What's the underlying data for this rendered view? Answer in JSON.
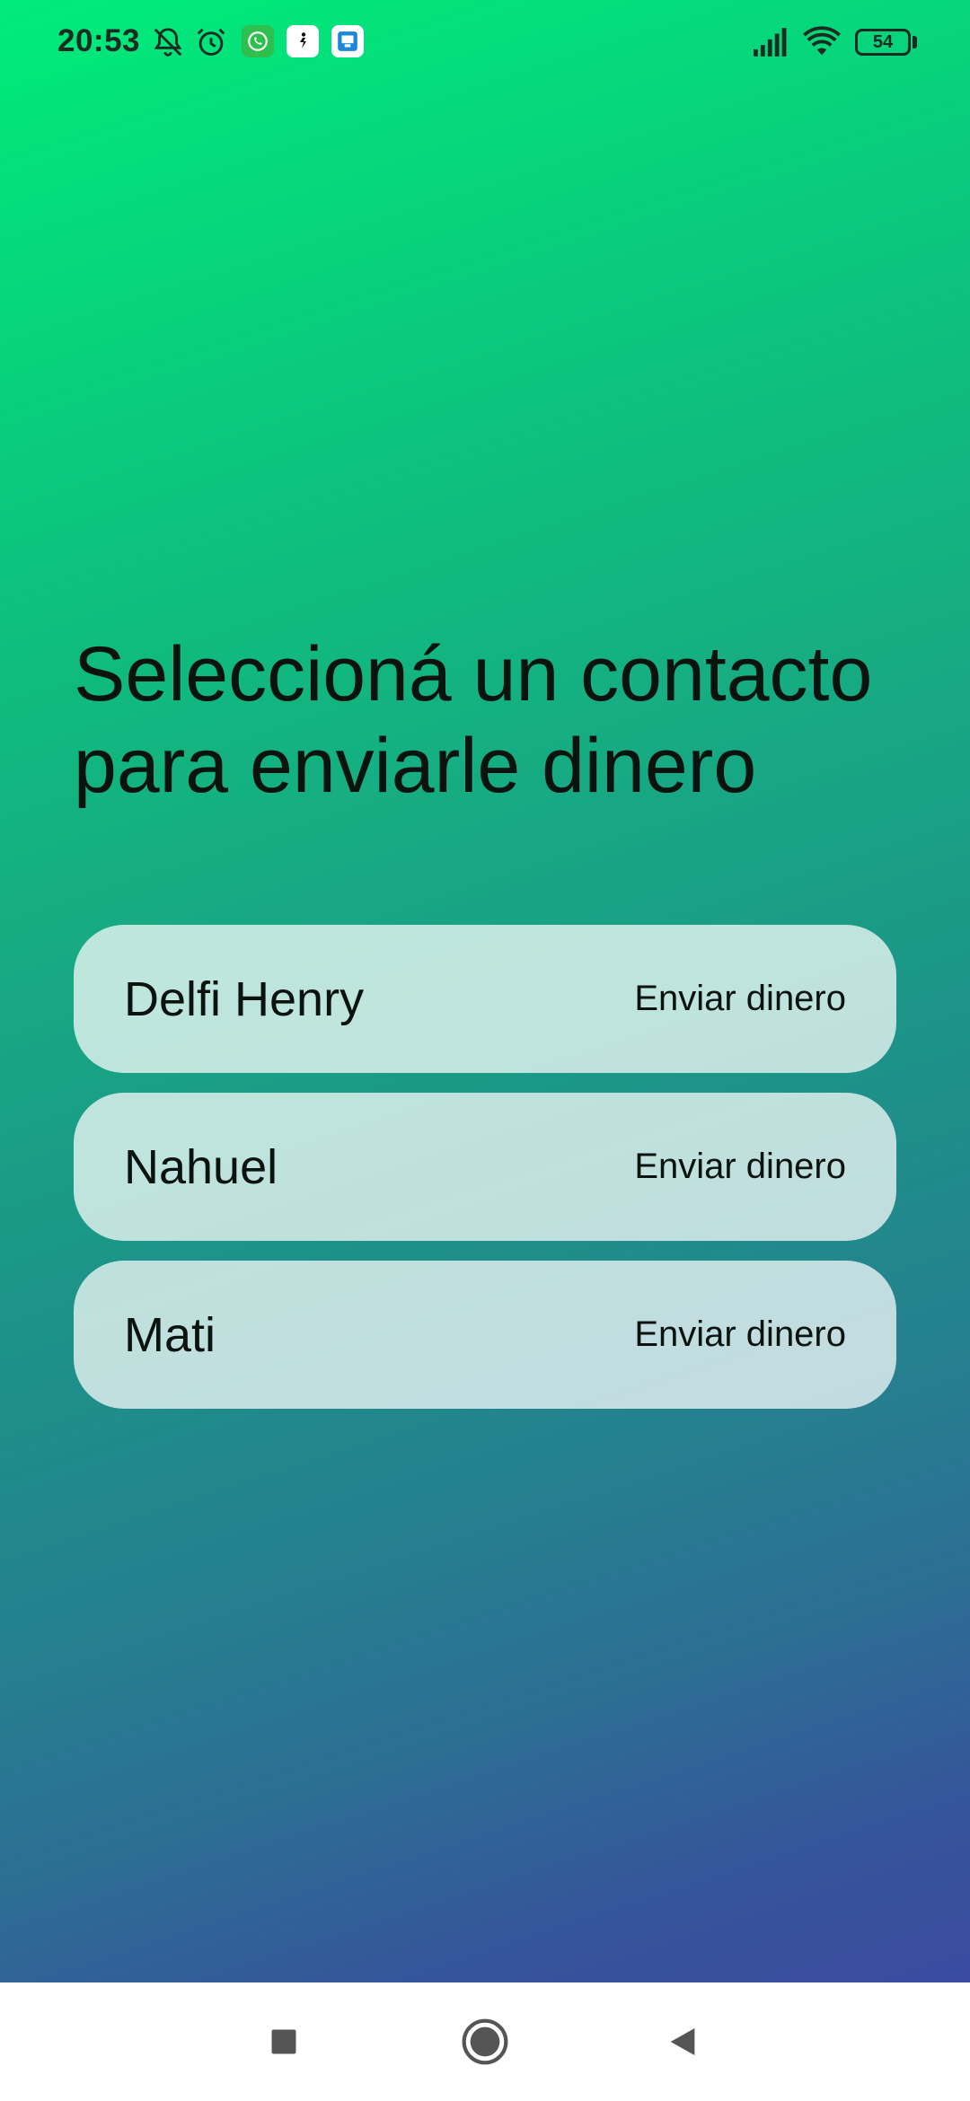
{
  "status_bar": {
    "time": "20:53",
    "battery_level": "54",
    "icons": [
      "bell-off-icon",
      "alarm-icon",
      "whatsapp-icon",
      "app-notification-icon",
      "app-notification-icon-2",
      "signal-icon",
      "wifi-icon",
      "battery-icon"
    ]
  },
  "main": {
    "title_line_1": "Seleccioná un contacto",
    "title_line_2": "para enviarle dinero"
  },
  "contacts": [
    {
      "name": "Delfi Henry",
      "action": "Enviar dinero"
    },
    {
      "name": "Nahuel",
      "action": "Enviar dinero"
    },
    {
      "name": "Mati",
      "action": "Enviar dinero"
    }
  ],
  "nav_bar": {
    "buttons": [
      "recents-square-icon",
      "home-circle-icon",
      "back-triangle-icon"
    ]
  },
  "colors": {
    "gradient_top": "#00ec7a",
    "gradient_bottom": "#3b4ba0",
    "card_background": "rgba(255,255,255,0.72)",
    "text": "#0b130f"
  }
}
